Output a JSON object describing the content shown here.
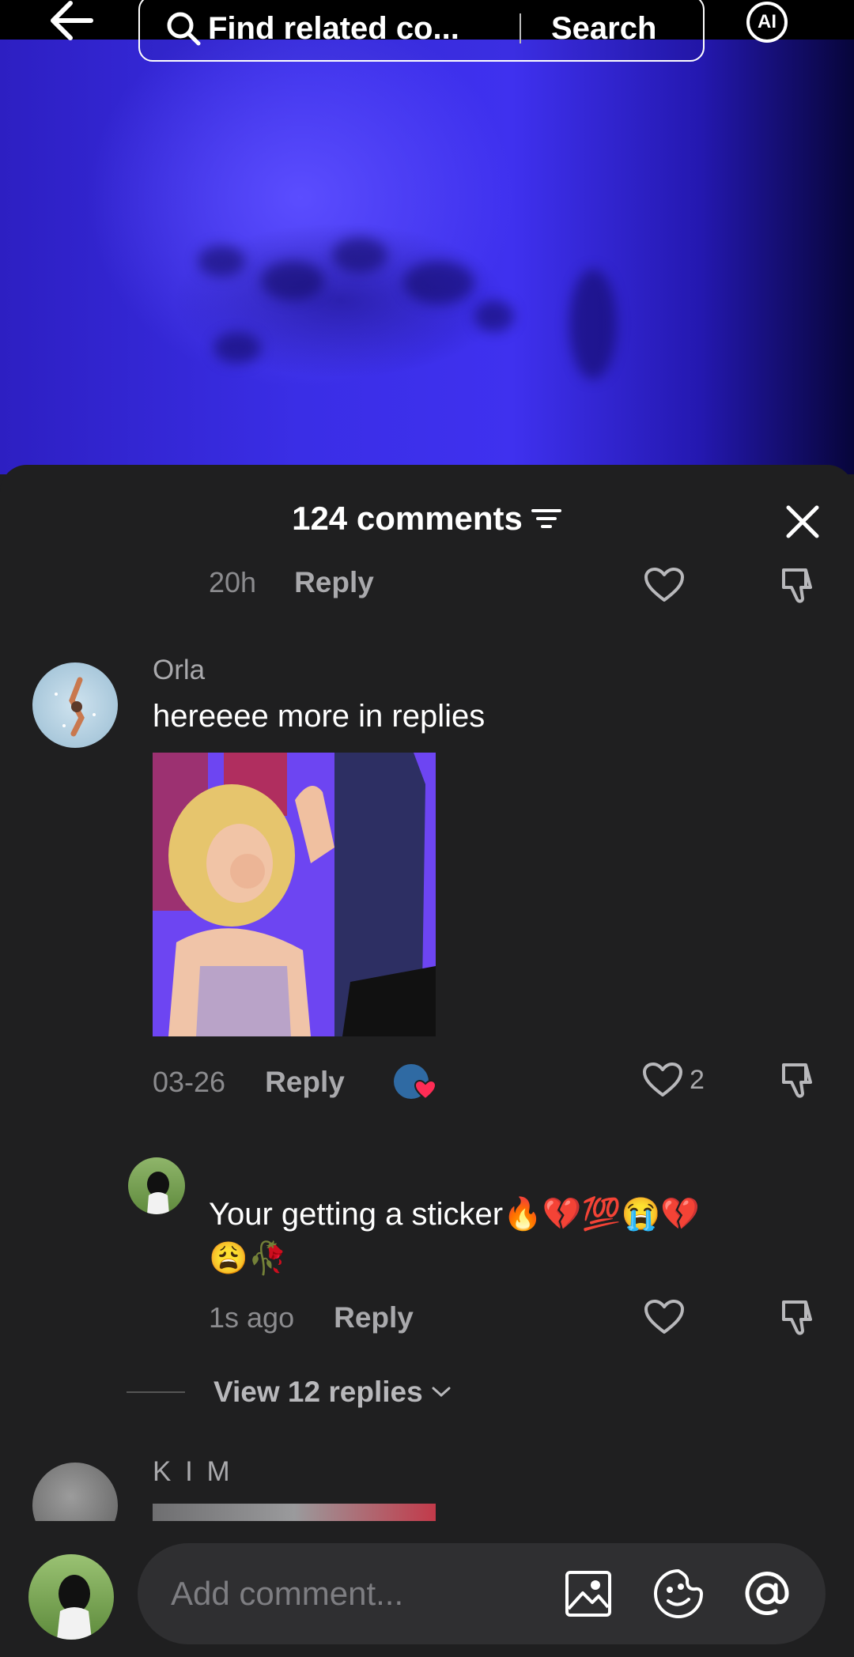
{
  "top_bar": {
    "search_placeholder": "Find related co...",
    "search_button": "Search",
    "ai_badge": "AI"
  },
  "sheet": {
    "title": "124 comments"
  },
  "comments": [
    {
      "time": "20h",
      "reply_label": "Reply"
    },
    {
      "username": "Orla",
      "text": "hereeee more in replies",
      "time": "03-26",
      "reply_label": "Reply",
      "like_count": "2"
    },
    {
      "text_line1": "Your getting a sticker🔥💔💯😭💔",
      "text_line2": "😩🥀",
      "time": "1s ago",
      "reply_label": "Reply"
    },
    {
      "username": "K I M"
    }
  ],
  "view_replies": "View 12 replies",
  "composer": {
    "placeholder": "Add comment..."
  }
}
